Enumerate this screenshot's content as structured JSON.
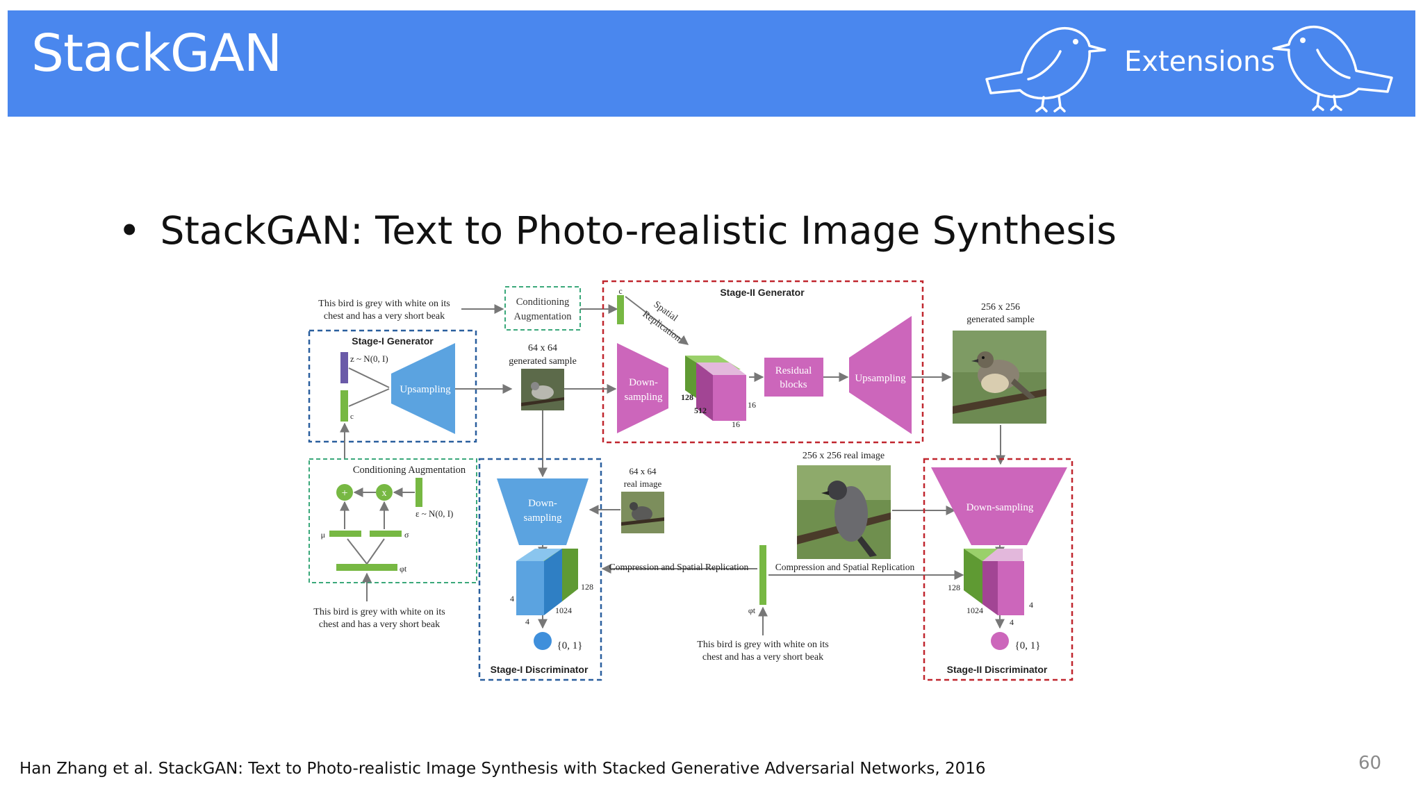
{
  "slide": {
    "title": "StackGAN",
    "section": "Extensions",
    "bullet": "StackGAN: Text to Photo-realistic Image Synthesis",
    "citation": "Han Zhang et al. StackGAN: Text to Photo-realistic Image Synthesis with Stacked Generative Adversarial Networks, 2016",
    "page_number": "60"
  },
  "colors": {
    "header": "#4a87ee",
    "blue_block": "#5ba3e0",
    "pink_block": "#cc66bb",
    "green_vector": "#77b843",
    "stage1_border": "#2a5f9e",
    "stage2_border": "#c0262e",
    "ca_border": "#3aa87a"
  },
  "diagram": {
    "text_top_left": [
      "This bird is grey with white on its",
      "chest and has a very short beak"
    ],
    "conditioning_aug_box": [
      "Conditioning",
      "Augmentation"
    ],
    "c_label": "c",
    "spatial_replication": [
      "Spatial",
      "Replication"
    ],
    "stage2_generator": "Stage-II Generator",
    "sample_256_label": [
      "256 x 256",
      "generated sample"
    ],
    "stage1_generator": "Stage-I Generator",
    "z_label": "z ~ N(0, I)",
    "upsampling": "Upsampling",
    "sample_64_label": [
      "64 x 64",
      "generated sample"
    ],
    "downsampling_2": [
      "Down-",
      "sampling"
    ],
    "residual_blocks": [
      "Residual",
      "blocks"
    ],
    "upsampling_2": "Upsampling",
    "dims_g2": [
      "128",
      "512",
      "16",
      "16"
    ],
    "ca_title": "Conditioning Augmentation",
    "plus": "+",
    "times": "x",
    "eps_label": "ε ~ N(0, I)",
    "mu": "μ",
    "sigma": "σ",
    "phi_t": "φt",
    "text_bottom_left": [
      "This bird is grey with white on its",
      "chest and has a very short beak"
    ],
    "real_64_label": [
      "64 x 64",
      "real image"
    ],
    "downsampling_d1": [
      "Down-",
      "sampling"
    ],
    "dims_d1": [
      "128",
      "4",
      "1024",
      "4"
    ],
    "output_01_a": "{0, 1}",
    "stage1_discriminator": "Stage-I Discriminator",
    "real_256_label": "256 x 256 real image",
    "compression_left": "Compression and Spatial Replication",
    "compression_right": "Compression and Spatial Replication",
    "phi_t_center": "φt",
    "text_bottom_center": [
      "This bird is grey with white on its",
      "chest and has a very short beak"
    ],
    "downsampling_d2": "Down-sampling",
    "dims_d2": [
      "128",
      "1024",
      "4",
      "4"
    ],
    "output_01_b": "{0, 1}",
    "stage2_discriminator": "Stage-II Discriminator"
  }
}
